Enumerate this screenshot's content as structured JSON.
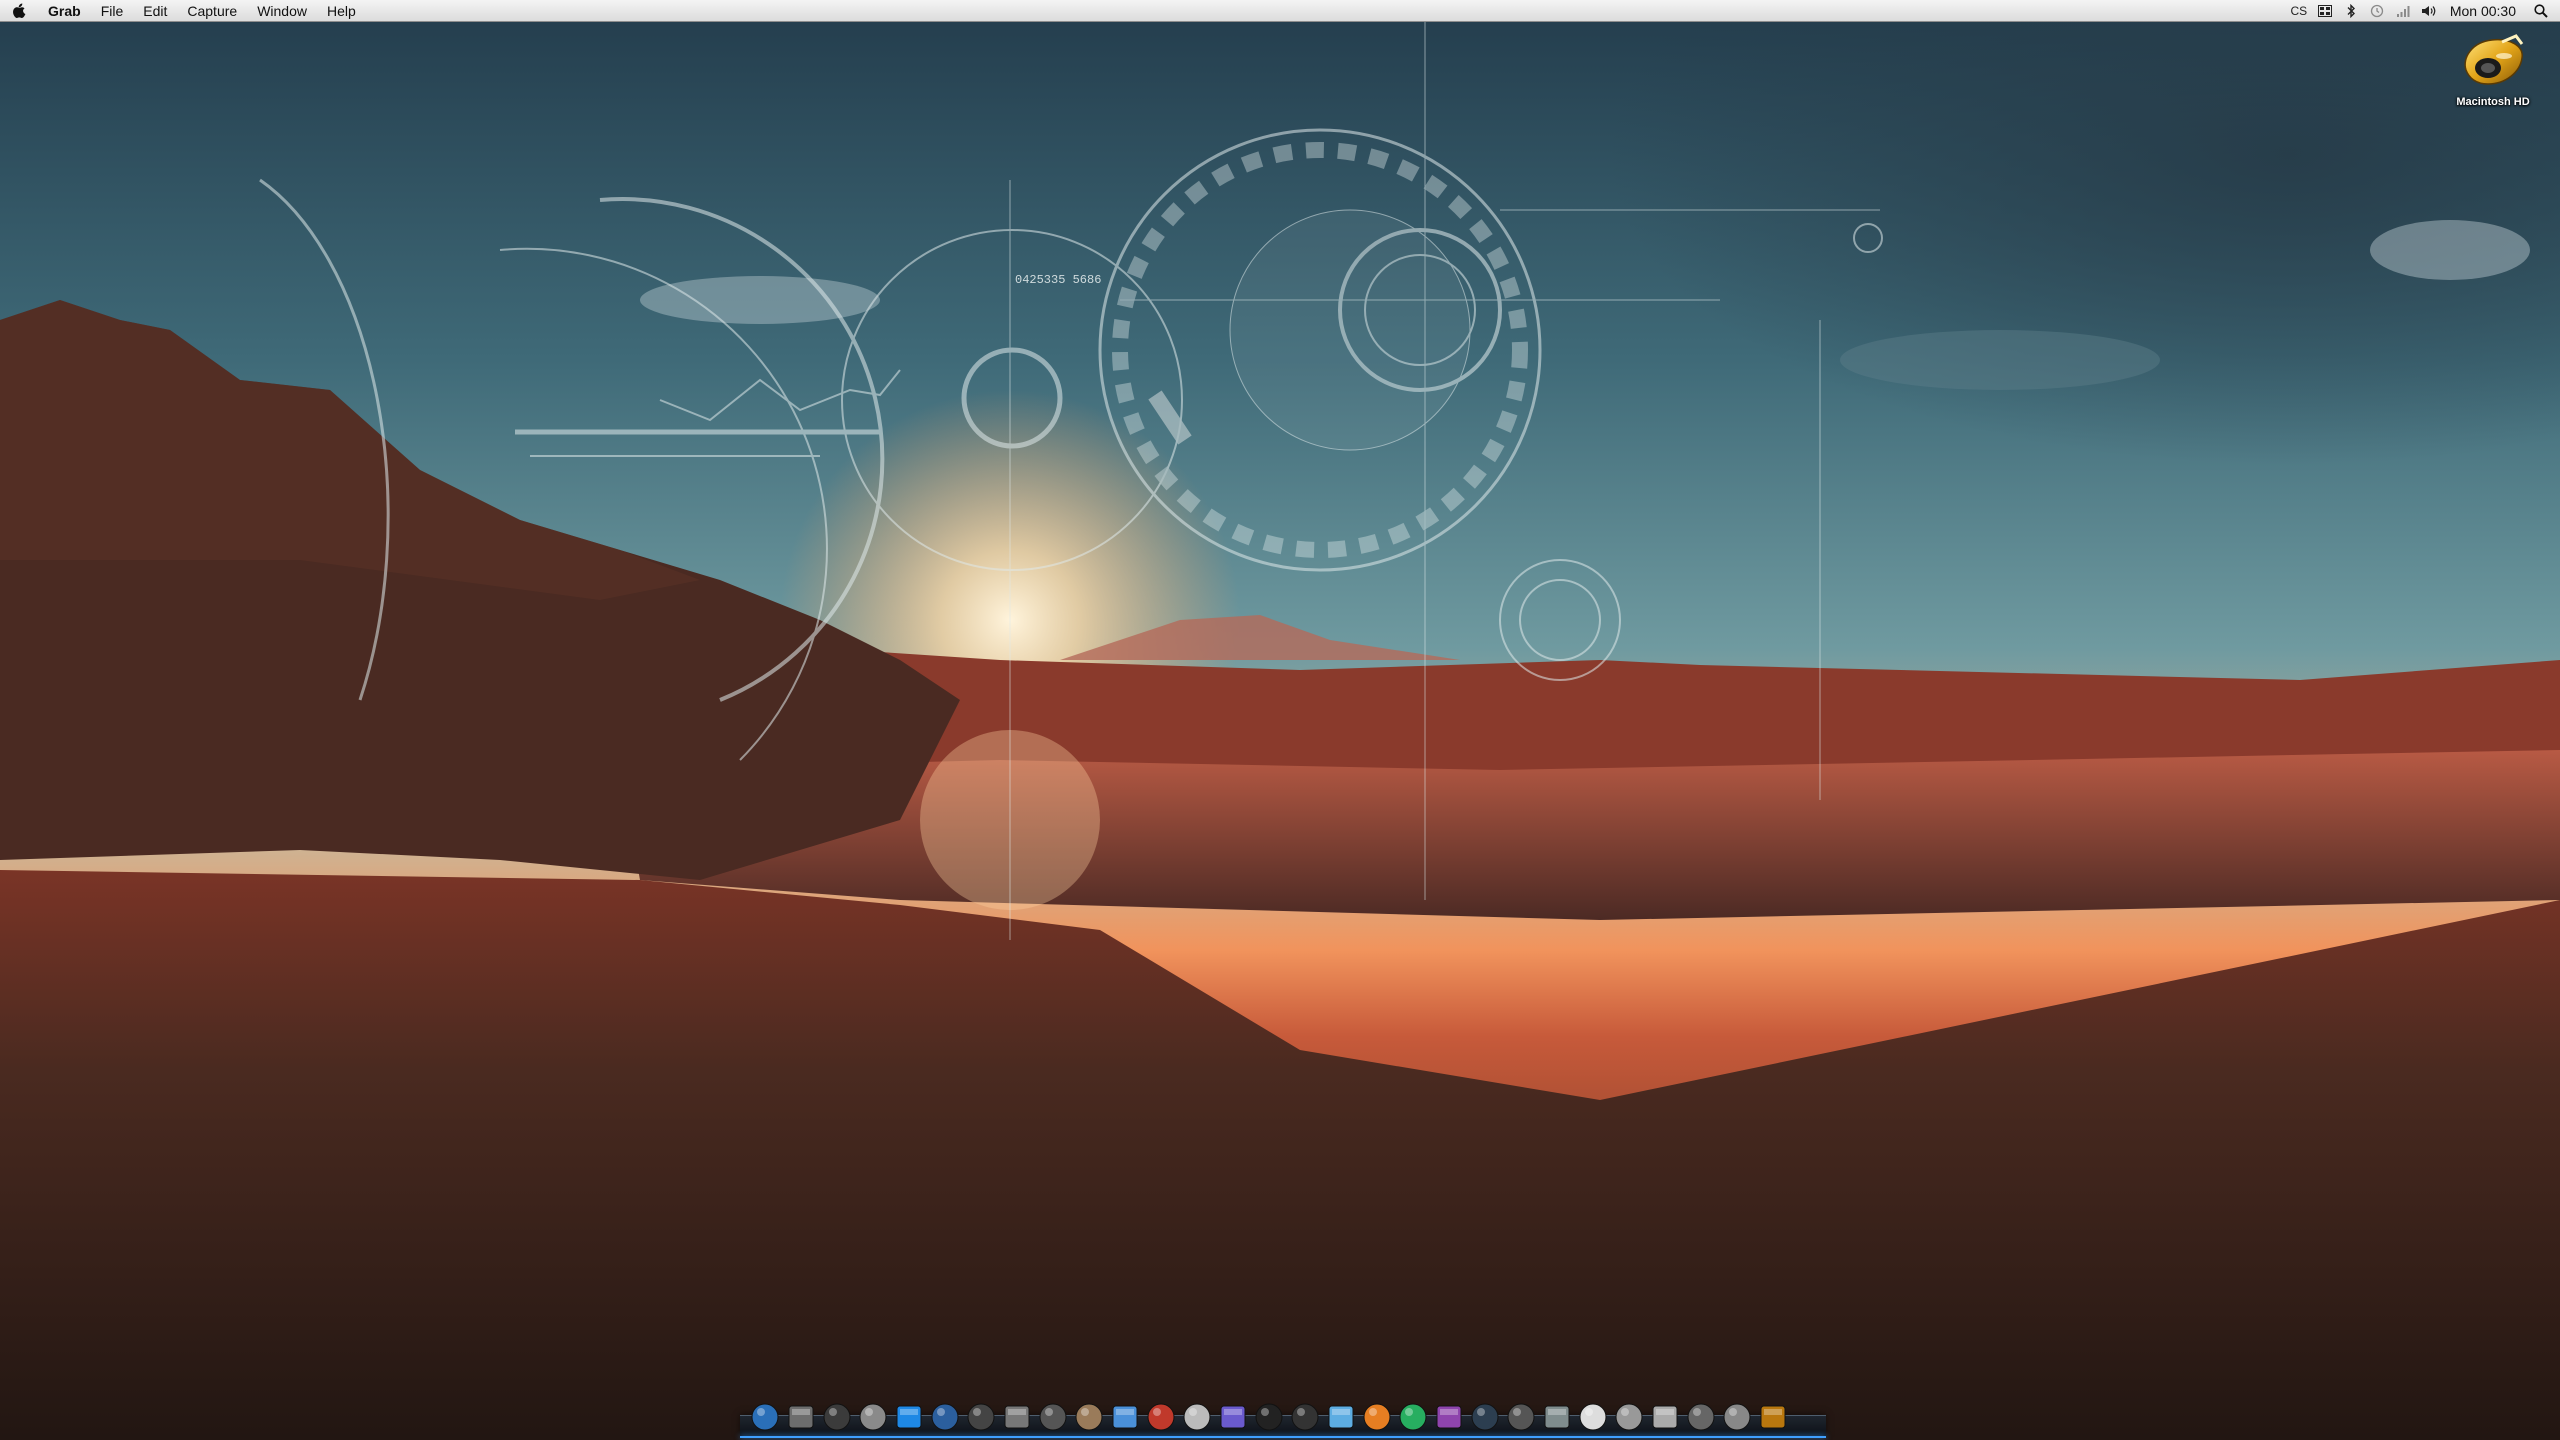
{
  "menubar": {
    "apple_symbol": "",
    "app_name": "Grab",
    "menus": [
      "File",
      "Edit",
      "Capture",
      "Window",
      "Help"
    ],
    "status": {
      "cs_label": "CS",
      "icons": [
        "display-icon",
        "bluetooth-icon",
        "time-machine-icon",
        "wifi-icon",
        "volume-icon"
      ],
      "clock": "Mon 00:30"
    }
  },
  "desktop": {
    "icons": [
      {
        "label": "Macintosh HD",
        "icon": "hard-drive-icon"
      }
    ],
    "wallpaper_text": "0425335 5686"
  },
  "dock": {
    "items": [
      "finder-icon",
      "globe-icon",
      "disk-icon",
      "preview-icon",
      "safari-icon",
      "world-icon",
      "camera-icon",
      "folder-icon",
      "notebook-icon",
      "script-icon",
      "itunes-icon",
      "photos-icon",
      "automator-icon",
      "moon-icon",
      "xbox-icon",
      "clapper-icon",
      "gears-icon",
      "color-wheel-icon",
      "film-icon",
      "disc-icon",
      "terminal-icon",
      "keyboard-icon",
      "app-store-icon",
      "notepad-icon",
      "separator-icon",
      "downloads-icon",
      "trash-icon",
      "arrow-icon",
      "spaceship-icon"
    ]
  },
  "colors": {
    "menubar_bg": "#e8e8e8",
    "dock_glow": "#3fa0ff",
    "sky_top": "#2c4a58",
    "horizon": "#f0905a",
    "ground": "#3a2218"
  }
}
